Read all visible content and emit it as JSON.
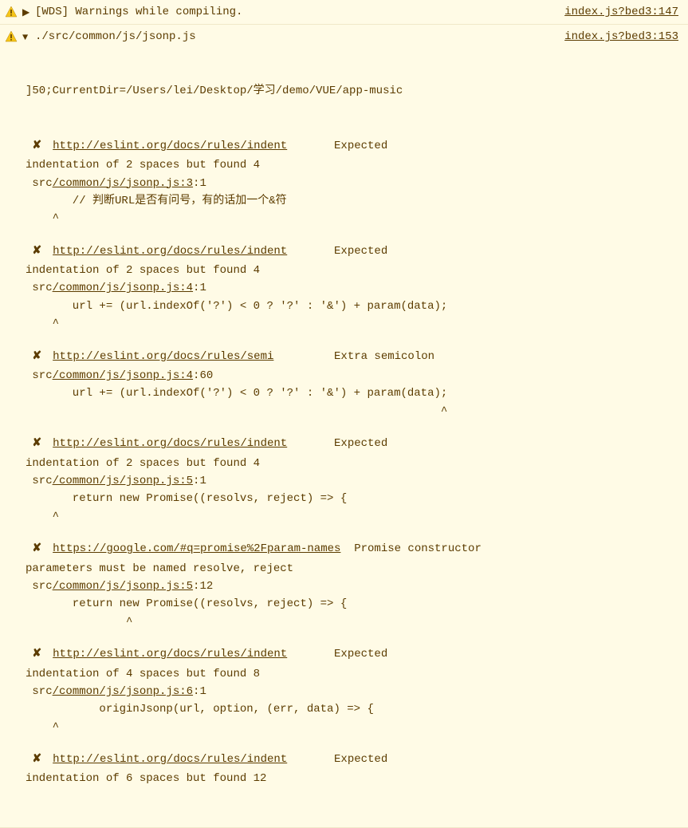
{
  "row1": {
    "title": "[WDS] Warnings while compiling.",
    "source": "index.js?bed3:147"
  },
  "row2": {
    "title": "./src/common/js/jsonp.js",
    "source": "index.js?bed3:153",
    "dirline": "]50;CurrentDir=/Users/lei/Desktop/学习/demo/VUE/app-music",
    "errors": [
      {
        "x": "✘",
        "link": "http://eslint.org/docs/rules/indent",
        "msg_pad": "       ",
        "msg": "Expected",
        "msg2": "indentation of 2 spaces but found 4",
        "file_pre": " src",
        "file_link": "/common/js/jsonp.js:3",
        "file_post": ":1",
        "code": "       // 判断URL是否有问号，有的话加一个&符",
        "caret": "    ^"
      },
      {
        "x": "✘",
        "link": "http://eslint.org/docs/rules/indent",
        "msg_pad": "       ",
        "msg": "Expected",
        "msg2": "indentation of 2 spaces but found 4",
        "file_pre": " src",
        "file_link": "/common/js/jsonp.js:4",
        "file_post": ":1",
        "code": "       url += (url.indexOf('?') < 0 ? '?' : '&') + param(data);",
        "caret": "    ^"
      },
      {
        "x": "✘",
        "link": "http://eslint.org/docs/rules/semi",
        "msg_pad": "         ",
        "msg": "Extra semicolon",
        "msg2": "",
        "file_pre": " src",
        "file_link": "/common/js/jsonp.js:4",
        "file_post": ":60",
        "code": "       url += (url.indexOf('?') < 0 ? '?' : '&') + param(data);",
        "caret": "                                                              ^"
      },
      {
        "x": "✘",
        "link": "http://eslint.org/docs/rules/indent",
        "msg_pad": "       ",
        "msg": "Expected",
        "msg2": "indentation of 2 spaces but found 4",
        "file_pre": " src",
        "file_link": "/common/js/jsonp.js:5",
        "file_post": ":1",
        "code": "       return new Promise((resolvs, reject) => {",
        "caret": "    ^"
      },
      {
        "x": "✘",
        "link": "https://google.com/#q=promise%2Fparam-names",
        "msg_pad": "  ",
        "msg": "Promise constructor",
        "msg2": "parameters must be named resolve, reject",
        "file_pre": " src",
        "file_link": "/common/js/jsonp.js:5",
        "file_post": ":12",
        "code": "       return new Promise((resolvs, reject) => {",
        "caret": "               ^"
      },
      {
        "x": "✘",
        "link": "http://eslint.org/docs/rules/indent",
        "msg_pad": "       ",
        "msg": "Expected",
        "msg2": "indentation of 4 spaces but found 8",
        "file_pre": " src",
        "file_link": "/common/js/jsonp.js:6",
        "file_post": ":1",
        "code": "           originJsonp(url, option, (err, data) => {",
        "caret": "    ^"
      },
      {
        "x": "✘",
        "link": "http://eslint.org/docs/rules/indent",
        "msg_pad": "       ",
        "msg": "Expected",
        "msg2": "indentation of 6 spaces but found 12",
        "file_pre": "",
        "file_link": "",
        "file_post": "",
        "code": "",
        "caret": ""
      }
    ]
  }
}
